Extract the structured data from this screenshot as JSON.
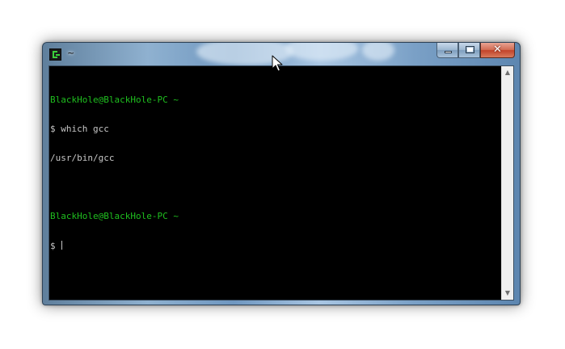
{
  "window": {
    "title": "~",
    "icon": "terminal-app-icon",
    "controls": {
      "minimize": "minimize-icon",
      "maximize": "maximize-icon",
      "close_glyph": "✕"
    }
  },
  "terminal": {
    "lines": [
      {
        "user": "BlackHole@BlackHole-PC",
        "path": " ~"
      },
      {
        "text": "$ which gcc"
      },
      {
        "text": "/usr/bin/gcc"
      },
      {
        "text": ""
      },
      {
        "user": "BlackHole@BlackHole-PC",
        "path": " ~"
      },
      {
        "text": "$ "
      }
    ],
    "colors": {
      "background": "#000000",
      "text": "#c6c6c6",
      "prompt_user": "#1fbf1f"
    }
  },
  "scrollbar": {
    "up_arrow": "▲",
    "down_arrow": "▼"
  }
}
